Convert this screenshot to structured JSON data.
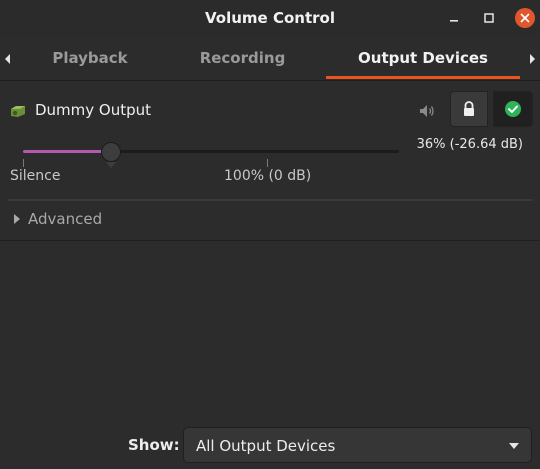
{
  "window": {
    "title": "Volume Control",
    "controls": {
      "minimize": "minimize-icon",
      "maximize": "maximize-icon",
      "close": "close-icon"
    }
  },
  "tabs": [
    {
      "label": "Playback",
      "active": false
    },
    {
      "label": "Recording",
      "active": false
    },
    {
      "label": "Output Devices",
      "active": true
    }
  ],
  "device": {
    "name": "Dummy Output",
    "icon": "speaker-device-icon",
    "volume_percent": 36,
    "volume_readout": "36% (-26.64 dB)",
    "scale_min_label": "Silence",
    "scale_mark_label": "100% (0 dB)",
    "muted": false,
    "locked": true,
    "is_default": true
  },
  "advanced": {
    "label": "Advanced",
    "expanded": false
  },
  "footer": {
    "show_label": "Show:",
    "show_value": "All Output Devices"
  },
  "colors": {
    "accent": "#e95420",
    "slider_fill": "#b458b0",
    "default_check": "#2eb35a",
    "close_button": "#e0572d"
  }
}
